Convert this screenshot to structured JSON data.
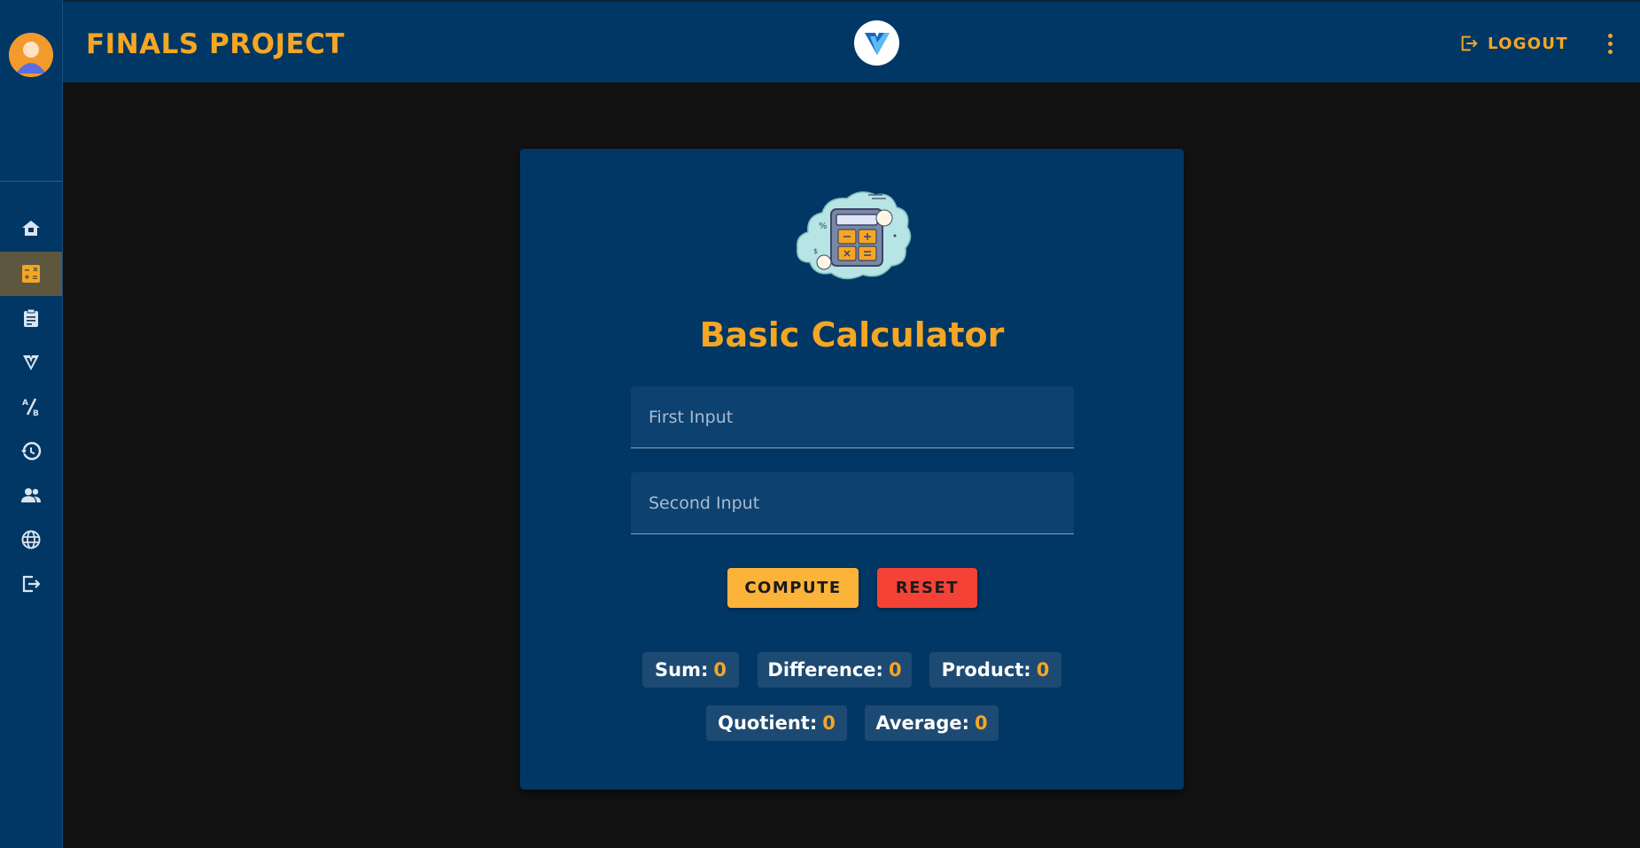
{
  "header": {
    "title": "FINALS PROJECT",
    "logout_label": "LOGOUT"
  },
  "sidebar": {
    "items": [
      {
        "icon": "home-icon"
      },
      {
        "icon": "calculator-icon",
        "active": true
      },
      {
        "icon": "clipboard-icon"
      },
      {
        "icon": "vuetify-icon"
      },
      {
        "icon": "fraction-icon"
      },
      {
        "icon": "history-icon"
      },
      {
        "icon": "users-icon"
      },
      {
        "icon": "globe-icon"
      },
      {
        "icon": "logout-icon"
      }
    ]
  },
  "calculator": {
    "title": "Basic Calculator",
    "first_placeholder": "First Input",
    "second_placeholder": "Second Input",
    "compute_label": "COMPUTE",
    "reset_label": "RESET",
    "results": {
      "sum_label": "Sum:",
      "sum_value": "0",
      "difference_label": "Difference:",
      "difference_value": "0",
      "product_label": "Product:",
      "product_value": "0",
      "quotient_label": "Quotient:",
      "quotient_value": "0",
      "average_label": "Average:",
      "average_value": "0"
    }
  },
  "colors": {
    "primary": "#003764",
    "accent": "#f5a623",
    "background": "#121212",
    "danger": "#f44336"
  }
}
